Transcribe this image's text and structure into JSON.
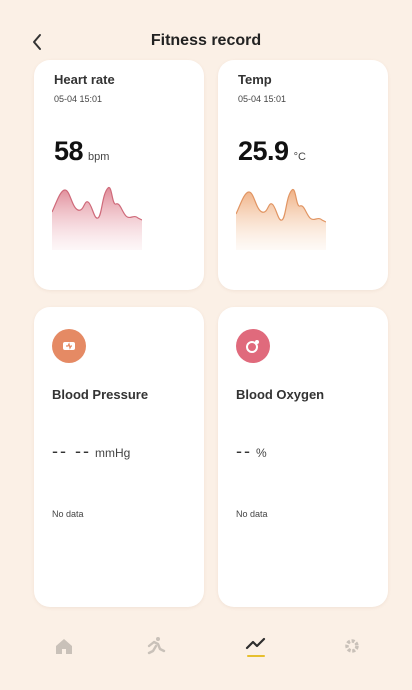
{
  "header": {
    "title": "Fitness record",
    "back_icon": "chevron-left-icon"
  },
  "metrics": {
    "heart_rate": {
      "title": "Heart rate",
      "time": "05-04 15:01",
      "value": "58",
      "unit": "bpm",
      "color": "#e49aa4"
    },
    "temp": {
      "title": "Temp",
      "time": "05-04 15:01",
      "value": "25.9",
      "unit": "°C",
      "color": "#f2b98c"
    }
  },
  "cards": {
    "blood_pressure": {
      "title": "Blood Pressure",
      "value": "-- --",
      "unit": "mmHg",
      "status": "No data",
      "icon": "heart-badge-icon",
      "color": "#e58a64"
    },
    "blood_oxygen": {
      "title": "Blood Oxygen",
      "value": "--",
      "unit": "%",
      "status": "No data",
      "icon": "oxygen-drop-icon",
      "color": "#e06a7c"
    }
  },
  "tabs": [
    {
      "name": "home",
      "icon": "home-icon",
      "active": false
    },
    {
      "name": "activity",
      "icon": "running-icon",
      "active": false
    },
    {
      "name": "records",
      "icon": "trend-chart-icon",
      "active": true
    },
    {
      "name": "settings",
      "icon": "gear-icon",
      "active": false
    }
  ],
  "colors": {
    "background": "#fbf0e6",
    "active_tab": "#e6bf2e",
    "inactive_tab": "#c9c1b9"
  }
}
